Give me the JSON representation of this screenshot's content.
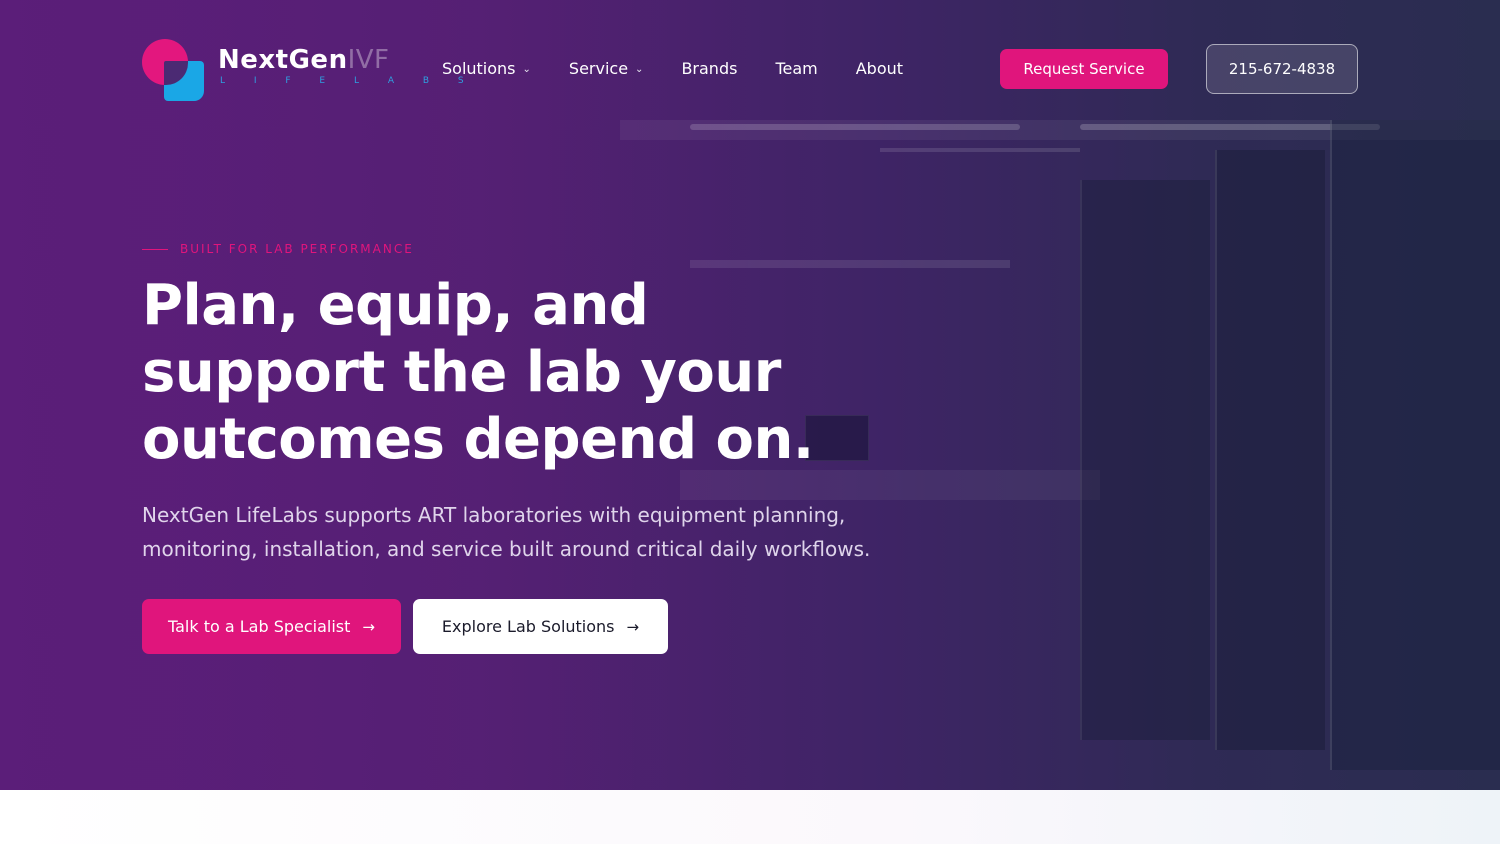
{
  "brand": {
    "name": "NextGen",
    "name_ghost": "IVF",
    "tagline": "L I F E L A B S"
  },
  "nav": {
    "items": [
      {
        "label": "Solutions",
        "has_dropdown": true
      },
      {
        "label": "Service",
        "has_dropdown": true
      },
      {
        "label": "Brands",
        "has_dropdown": false
      },
      {
        "label": "Team",
        "has_dropdown": false
      },
      {
        "label": "About",
        "has_dropdown": false
      }
    ],
    "dropdown_glyph": "⌄"
  },
  "header": {
    "request_label": "Request Service",
    "phone": "215-672-4838"
  },
  "hero": {
    "eyebrow": "BUILT FOR LAB PERFORMANCE",
    "headline": [
      "Plan, equip, and",
      "support the lab your",
      "outcomes depend on."
    ],
    "description": "NextGen LifeLabs supports ART laboratories with equipment planning, monitoring, installation, and service built around critical daily workflows.",
    "cta_primary": "Talk to a Lab Specialist",
    "cta_secondary": "Explore Lab Solutions",
    "arrow_glyph": "→"
  },
  "colors": {
    "accent": "#e0157c",
    "logo_blue": "#1aa7e6",
    "hero_purple": "#5a1e78",
    "hero_navy": "#2a2d50"
  },
  "icons": [
    "logo-mark-icon",
    "chevron-down-icon",
    "arrow-right-icon"
  ]
}
